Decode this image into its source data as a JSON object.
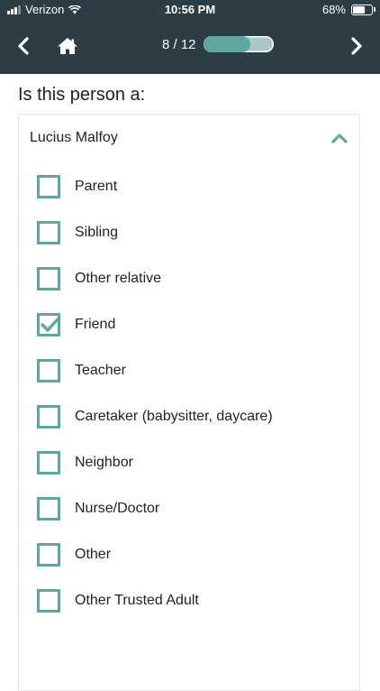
{
  "status_bar": {
    "carrier": "Verizon",
    "time": "10:56 PM",
    "battery": "68%"
  },
  "nav": {
    "progress_text": "8 / 12",
    "progress_fraction": 0.667
  },
  "colors": {
    "header_bg": "#2d3d46",
    "accent": "#5fa69f",
    "progress_track": "#a9c8c5"
  },
  "question": "Is this person a:",
  "person": {
    "name": "Lucius Malfoy",
    "expanded": true
  },
  "options": [
    {
      "label": "Parent",
      "checked": false
    },
    {
      "label": "Sibling",
      "checked": false
    },
    {
      "label": "Other relative",
      "checked": false
    },
    {
      "label": "Friend",
      "checked": true
    },
    {
      "label": "Teacher",
      "checked": false
    },
    {
      "label": "Caretaker (babysitter, daycare)",
      "checked": false
    },
    {
      "label": "Neighbor",
      "checked": false
    },
    {
      "label": "Nurse/Doctor",
      "checked": false
    },
    {
      "label": "Other",
      "checked": false
    },
    {
      "label": "Other Trusted Adult",
      "checked": false
    }
  ]
}
